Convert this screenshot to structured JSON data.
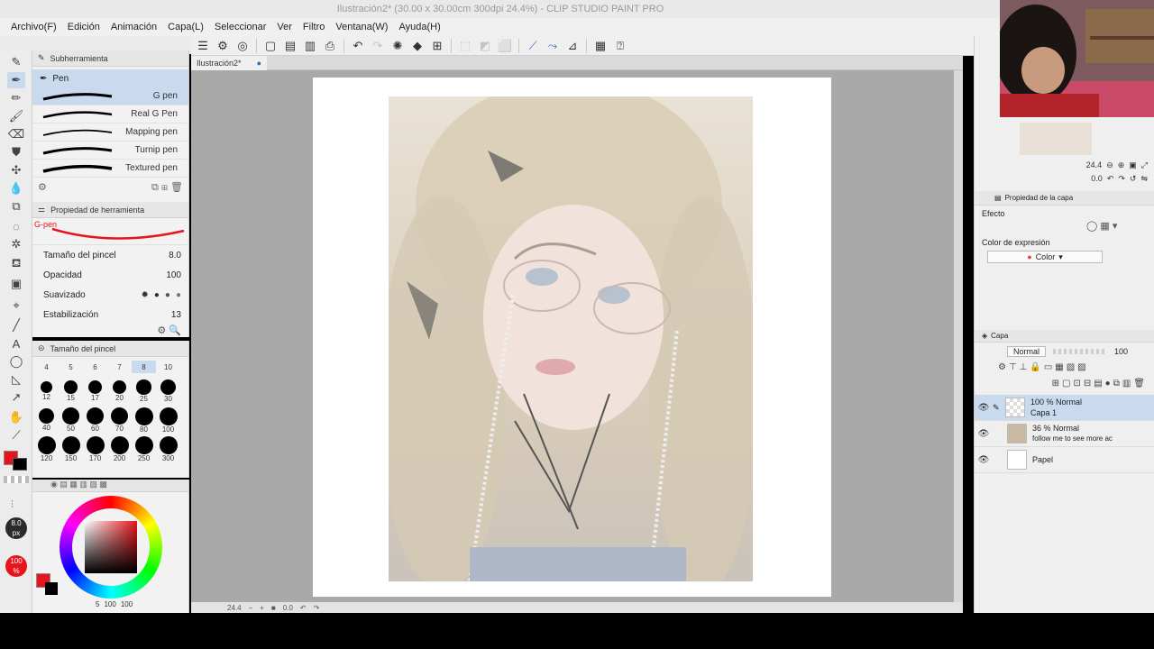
{
  "window": {
    "title": "Ilustración2* (30.00 x 30.00cm 300dpi 24.4%) - CLIP STUDIO PAINT PRO"
  },
  "menu": [
    "Archivo(F)",
    "Edición",
    "Animación",
    "Capa(L)",
    "Seleccionar",
    "Ver",
    "Filtro",
    "Ventana(W)",
    "Ayuda(H)"
  ],
  "document": {
    "tab_label": "Ilustración2*"
  },
  "subtool": {
    "header": "Subherramienta",
    "group": "Pen",
    "brushes": [
      {
        "label": "G pen",
        "selected": true
      },
      {
        "label": "Real G Pen",
        "selected": false
      },
      {
        "label": "Mapping pen",
        "selected": false
      },
      {
        "label": "Turnip pen",
        "selected": false
      },
      {
        "label": "Textured pen",
        "selected": false
      }
    ]
  },
  "tool_property": {
    "header": "Propiedad de herramienta",
    "brush_name": "G-pen",
    "size_label": "Tamaño del pincel",
    "size_value": "8.0",
    "opacity_label": "Opacidad",
    "opacity_value": "100",
    "smoothing_label": "Suavizado",
    "stabilization_label": "Estabilización",
    "stabilization_value": "13"
  },
  "brush_size": {
    "header": "Tamaño del pincel",
    "top_row": [
      "4",
      "5",
      "6",
      "7",
      "8",
      "10"
    ],
    "sizes": [
      "12",
      "15",
      "17",
      "20",
      "25",
      "30",
      "40",
      "50",
      "60",
      "70",
      "80",
      "100",
      "120",
      "150",
      "170",
      "200",
      "250",
      "300"
    ]
  },
  "color": {
    "main": "#e8141b",
    "sub": "#000000",
    "size_badge": "8.0\npx",
    "opacity_badge": "100\n%",
    "status": [
      "5",
      "100",
      "100"
    ]
  },
  "canvas_status": {
    "zoom": "24.4",
    "angle": "0.0"
  },
  "navigator": {
    "zoom": "24.4",
    "angle": "0.0"
  },
  "layer_property": {
    "header": "Propiedad de la capa",
    "effect_label": "Efecto",
    "expression_label": "Color de expresión",
    "expression_value": "Color"
  },
  "layers": {
    "header": "Capa",
    "blend_mode": "Normal",
    "opacity": "100",
    "items": [
      {
        "meta": "100 % Normal",
        "name": "Capa 1",
        "selected": true
      },
      {
        "meta": "36 % Normal",
        "name": "follow me to see more ac",
        "selected": false
      },
      {
        "meta": "",
        "name": "Papel",
        "selected": false
      }
    ]
  },
  "accent": {
    "selection": "#c9daef",
    "red": "#e8141b"
  }
}
